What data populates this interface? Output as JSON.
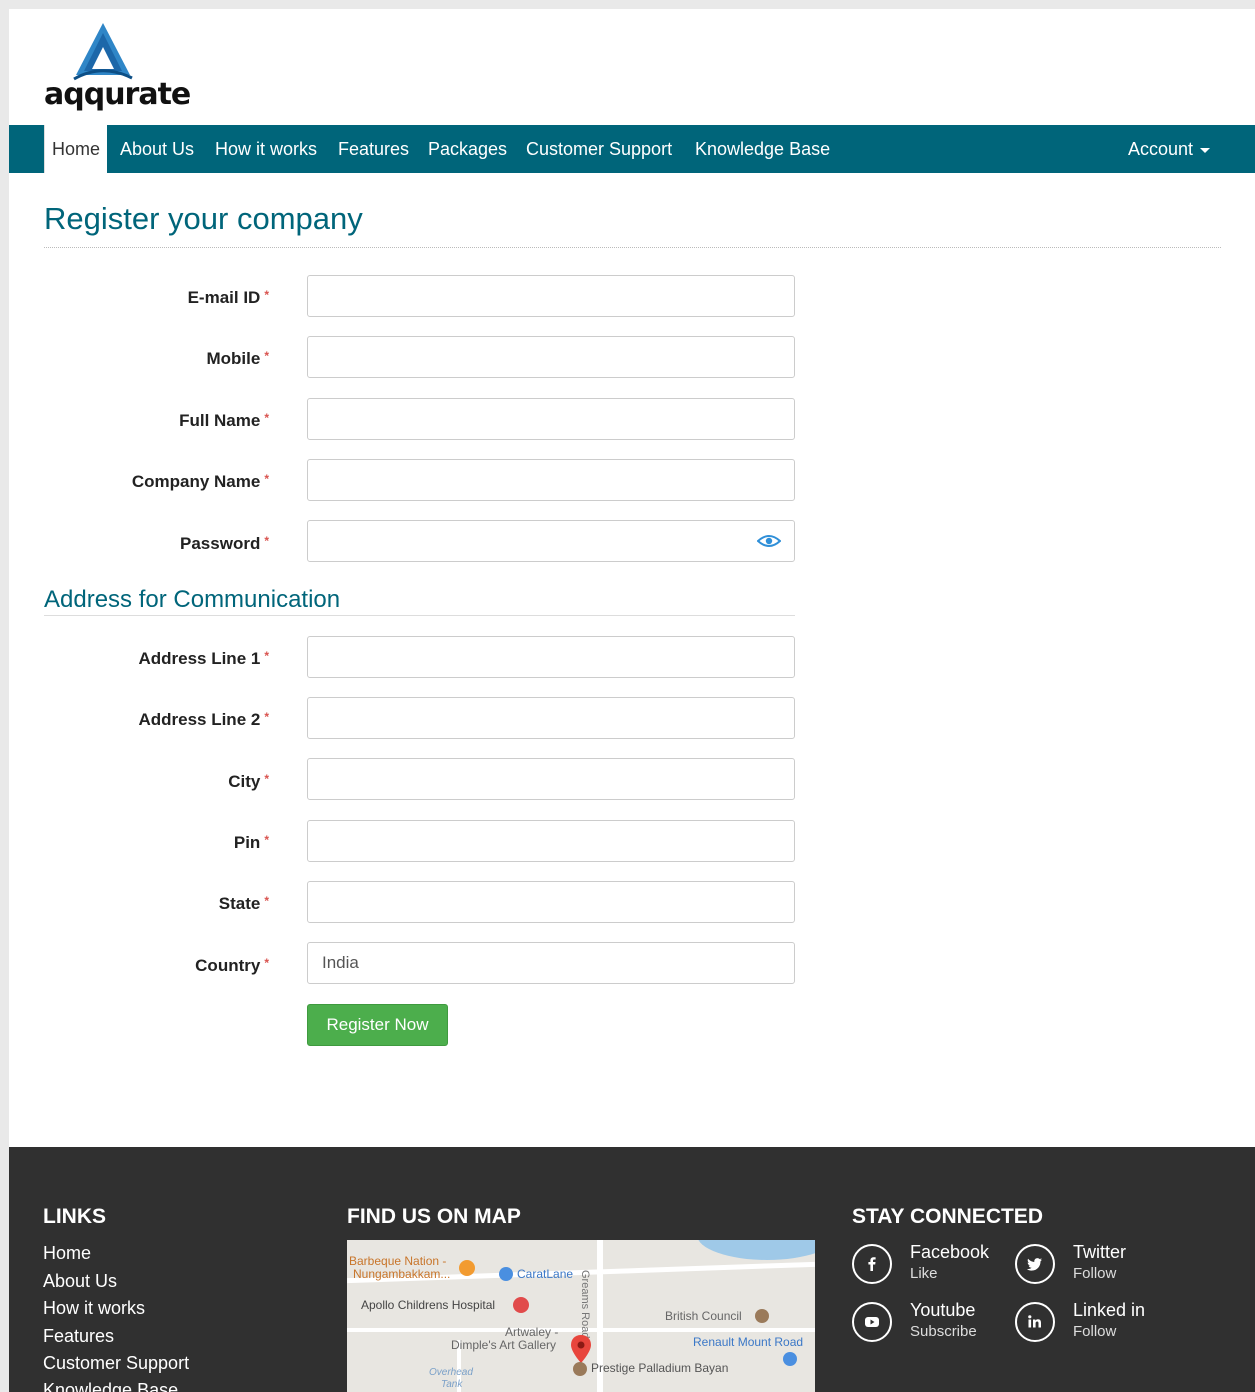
{
  "brand": {
    "logo_text": "aqqurate"
  },
  "nav": {
    "items": [
      {
        "label": "Home"
      },
      {
        "label": "About Us"
      },
      {
        "label": "How it works"
      },
      {
        "label": "Features"
      },
      {
        "label": "Packages"
      },
      {
        "label": "Customer Support"
      },
      {
        "label": "Knowledge Base"
      }
    ],
    "account_label": "Account",
    "active": "Home"
  },
  "page": {
    "title": "Register your company"
  },
  "form": {
    "required_mark": "*",
    "fields": {
      "email": {
        "label": "E-mail ID",
        "value": ""
      },
      "mobile": {
        "label": "Mobile",
        "value": ""
      },
      "full_name": {
        "label": "Full Name",
        "value": ""
      },
      "company_name": {
        "label": "Company Name",
        "value": ""
      },
      "password": {
        "label": "Password",
        "value": ""
      },
      "address1": {
        "label": "Address Line 1",
        "value": ""
      },
      "address2": {
        "label": "Address Line 2",
        "value": ""
      },
      "city": {
        "label": "City",
        "value": ""
      },
      "pin": {
        "label": "Pin",
        "value": ""
      },
      "state": {
        "label": "State",
        "value": ""
      },
      "country": {
        "label": "Country",
        "value": "India"
      }
    },
    "address_section_title": "Address for Communication",
    "submit_label": "Register Now"
  },
  "footer": {
    "links_heading": "LINKS",
    "links": [
      "Home",
      "About Us",
      "How it works",
      "Features",
      "Customer Support",
      "Knowledge Base"
    ],
    "map_heading": "FIND US ON MAP",
    "map_labels": {
      "l1": "Barbeque Nation -",
      "l2": "Nungambakkam...",
      "l3": "CaratLane",
      "l4": "Apollo Childrens Hospital",
      "l5": "Greams Road",
      "l6": "British Council",
      "l7": "Artwaley -",
      "l8": "Dimple's Art Gallery",
      "l9": "Renault Mount Road",
      "l10": "Overhead",
      "l11": "Tank",
      "l12": "Prestige Palladium Bayan"
    },
    "social_heading": "STAY CONNECTED",
    "social": {
      "facebook": {
        "name": "Facebook",
        "action": "Like"
      },
      "twitter": {
        "name": "Twitter",
        "action": "Follow"
      },
      "youtube": {
        "name": "Youtube",
        "action": "Subscribe"
      },
      "linkedin": {
        "name": "Linked in",
        "action": "Follow"
      }
    }
  },
  "colors": {
    "primary": "#00657a",
    "success": "#4cae4c",
    "footer": "#303030",
    "required": "#d9534f"
  }
}
